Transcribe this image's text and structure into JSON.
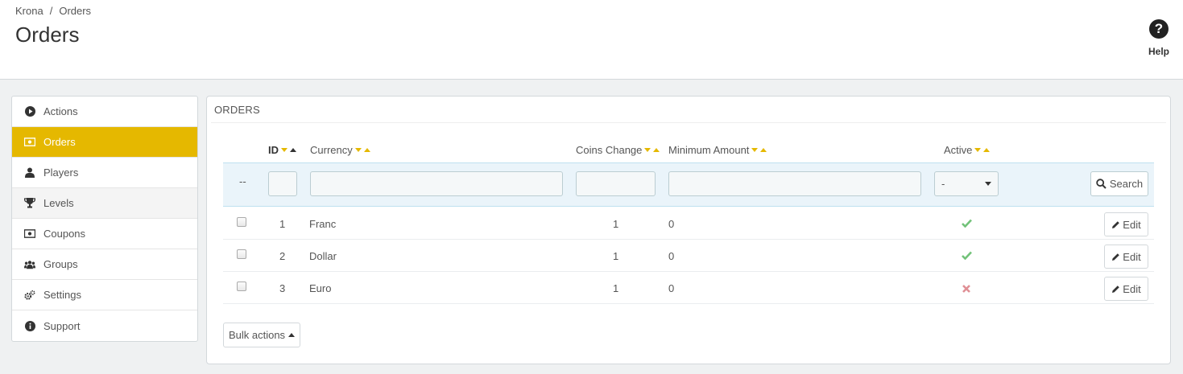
{
  "breadcrumb": {
    "root": "Krona",
    "separator": "/",
    "current": "Orders"
  },
  "page_title": "Orders",
  "help": {
    "label": "Help",
    "icon": "question-circle-icon"
  },
  "sidebar": {
    "items": [
      {
        "label": "Actions",
        "icon": "play-circle-icon"
      },
      {
        "label": "Orders",
        "icon": "money-icon",
        "active": true
      },
      {
        "label": "Players",
        "icon": "user-icon"
      },
      {
        "label": "Levels",
        "icon": "trophy-icon"
      },
      {
        "label": "Coupons",
        "icon": "money-icon"
      },
      {
        "label": "Groups",
        "icon": "users-icon"
      },
      {
        "label": "Settings",
        "icon": "gears-icon"
      },
      {
        "label": "Support",
        "icon": "info-circle-icon"
      }
    ]
  },
  "panel": {
    "heading": "ORDERS",
    "columns": {
      "id": "ID",
      "currency": "Currency",
      "coins_change": "Coins Change",
      "minimum_amount": "Minimum Amount",
      "active": "Active"
    },
    "filter": {
      "dash": "--",
      "active_select_value": "-",
      "search_label": "Search"
    },
    "rows": [
      {
        "id": "1",
        "currency": "Franc",
        "coins_change": "1",
        "minimum_amount": "0",
        "active": true
      },
      {
        "id": "2",
        "currency": "Dollar",
        "coins_change": "1",
        "minimum_amount": "0",
        "active": true
      },
      {
        "id": "3",
        "currency": "Euro",
        "coins_change": "1",
        "minimum_amount": "0",
        "active": false
      }
    ],
    "edit_label": "Edit",
    "bulk_actions_label": "Bulk actions"
  },
  "colors": {
    "accent": "#e5b800",
    "check": "#72c279",
    "cross": "#e08f95",
    "filter_bg": "#eaf4fa"
  }
}
